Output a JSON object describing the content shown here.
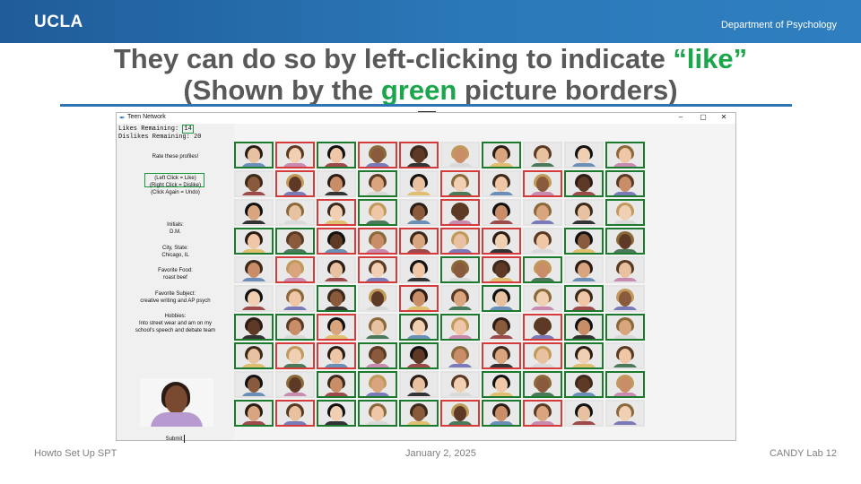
{
  "slide": {
    "logo": "UCLA",
    "department": "Department of Psychology",
    "title_pre": "They can do so by left-clicking to indicate ",
    "title_hl1": "“like”",
    "title_mid": "(Shown by the ",
    "title_hl2": "green",
    "title_post": " picture borders)",
    "footer_left": "Howto Set Up SPT",
    "footer_mid": "January 2, 2025",
    "footer_right": "CANDY Lab 12",
    "accent_green": "#1aa64a",
    "rule_color": "#2e75b6"
  },
  "window": {
    "title": "Teen Network",
    "minimize": "–",
    "maximize": "▢",
    "close": "✕",
    "likes_label": "Likes Remaining:",
    "likes_value": "14",
    "dislikes_label": "Dislikes Remaining:",
    "dislikes_value": "20",
    "rate_prompt": "Rate these profiles!",
    "instr1": "(Left Click = Like)",
    "instr2": "(Right Click = Dislike)",
    "instr3": "(Click Again = Undo)",
    "initials_label": "Initials:",
    "initials_value": "D.M.",
    "city_label": "City, State:",
    "city_value": "Chicago, IL",
    "food_label": "Favorite Food:",
    "food_value": "roast beef",
    "subject_label": "Favorite Subject:",
    "subject_value": "creative writing and AP psych",
    "hobbies_label": "Hobbies:",
    "hobbies_line1": "Into street wear and am on my",
    "hobbies_line2": "school's speech and debate team",
    "submit_label": "Submit",
    "like_color": "#1c7a2e",
    "dislike_color": "#d63b3b",
    "grid_rows": 10,
    "grid_cols": 10,
    "ratings": [
      "LDLDDNLNNL",
      "NDNLNDNDLL",
      "NNDLNDNNNL",
      "LLDDDDDNLL",
      "NDNDNLDLNN",
      "NNLNDNLNLN",
      "LLDNLLNDLL",
      "LDDLLNDDLN",
      "NNLLNNLLLL",
      "LDLLLDLDNN"
    ]
  }
}
